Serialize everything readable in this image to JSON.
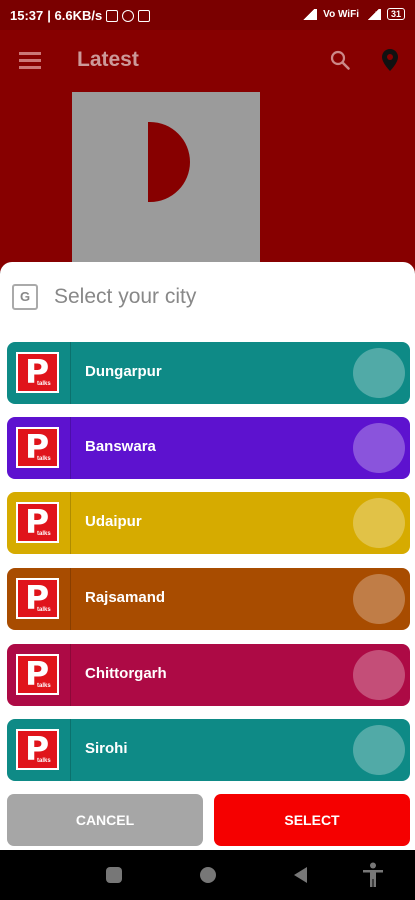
{
  "status_bar": {
    "time": "15:37",
    "speed": "| 6.6KB/s",
    "network": "Vo WiFi",
    "battery": "31"
  },
  "app_bar": {
    "title": "Latest",
    "menu_icon": "hamburger-menu-icon",
    "search_icon": "search-icon",
    "location_icon": "location-pin-icon"
  },
  "sheet": {
    "title": "Select your city",
    "icon": "translate-icon",
    "icon_glyph": "G"
  },
  "logo": {
    "letter": "P",
    "tag": "talks"
  },
  "cities": [
    {
      "name": "Dungarpur",
      "color": "#0e8a86"
    },
    {
      "name": "Banswara",
      "color": "#5d12cf"
    },
    {
      "name": "Udaipur",
      "color": "#d6ab00"
    },
    {
      "name": "Rajsamand",
      "color": "#a84c00"
    },
    {
      "name": "Chittorgarh",
      "color": "#ad0a45"
    },
    {
      "name": "Sirohi",
      "color": "#0e8a86"
    }
  ],
  "buttons": {
    "cancel": "CANCEL",
    "select": "SELECT"
  },
  "colors": {
    "header_bg": "#870000",
    "select_button": "#f50000",
    "cancel_button": "#a6a6a6"
  }
}
